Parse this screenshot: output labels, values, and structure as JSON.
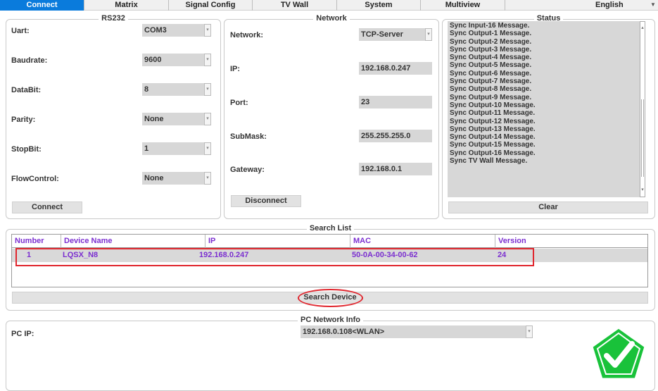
{
  "tabs": [
    {
      "label": "Connect",
      "active": true
    },
    {
      "label": "Matrix"
    },
    {
      "label": "Signal Config"
    },
    {
      "label": "TV Wall"
    },
    {
      "label": "System"
    },
    {
      "label": "Multiview"
    }
  ],
  "language": {
    "value": "English"
  },
  "rs232": {
    "title": "RS232",
    "uart": {
      "label": "Uart:",
      "value": "COM3"
    },
    "baudrate": {
      "label": "Baudrate:",
      "value": "9600"
    },
    "databit": {
      "label": "DataBit:",
      "value": "8"
    },
    "parity": {
      "label": "Parity:",
      "value": "None"
    },
    "stopbit": {
      "label": "StopBit:",
      "value": "1"
    },
    "flowcontrol": {
      "label": "FlowControl:",
      "value": "None"
    },
    "connect_label": "Connect"
  },
  "network": {
    "title": "Network",
    "network": {
      "label": "Network:",
      "value": "TCP-Server"
    },
    "ip": {
      "label": "IP:",
      "value": "192.168.0.247"
    },
    "port": {
      "label": "Port:",
      "value": "23"
    },
    "submask": {
      "label": "SubMask:",
      "value": "255.255.255.0"
    },
    "gateway": {
      "label": "Gateway:",
      "value": "192.168.0.1"
    },
    "disconnect_label": "Disconnect"
  },
  "status": {
    "title": "Status",
    "lines": [
      "Sync Input-16 Message.",
      "Sync Output-1 Message.",
      "Sync Output-2 Message.",
      "Sync Output-3 Message.",
      "Sync Output-4 Message.",
      "Sync Output-5 Message.",
      "Sync Output-6 Message.",
      "Sync Output-7 Message.",
      "Sync Output-8 Message.",
      "Sync Output-9 Message.",
      "Sync Output-10 Message.",
      "Sync Output-11 Message.",
      "Sync Output-12 Message.",
      "Sync Output-13 Message.",
      "Sync Output-14 Message.",
      "Sync Output-15 Message.",
      "Sync Output-16 Message.",
      "Sync TV Wall Message."
    ],
    "clear_label": "Clear"
  },
  "search_list": {
    "title": "Search List",
    "columns": [
      "Number",
      "Device Name",
      "IP",
      "MAC",
      "Version"
    ],
    "rows": [
      {
        "number": "1",
        "device_name": "LQSX_N8",
        "ip": "192.168.0.247",
        "mac": "50-0A-00-34-00-62",
        "version": "24"
      }
    ],
    "search_label": "Search Device"
  },
  "pc_network": {
    "title": "PC Network Info",
    "pc_ip_label": "PC IP:",
    "pc_ip_value": "192.168.0.108<WLAN>"
  },
  "icons": {
    "ok_badge": "check-pentagon-icon"
  },
  "colors": {
    "tab_active": "#0a7bdc",
    "table_text": "#7b2fd0",
    "highlight": "#e0262e",
    "badge": "#19c23a"
  }
}
